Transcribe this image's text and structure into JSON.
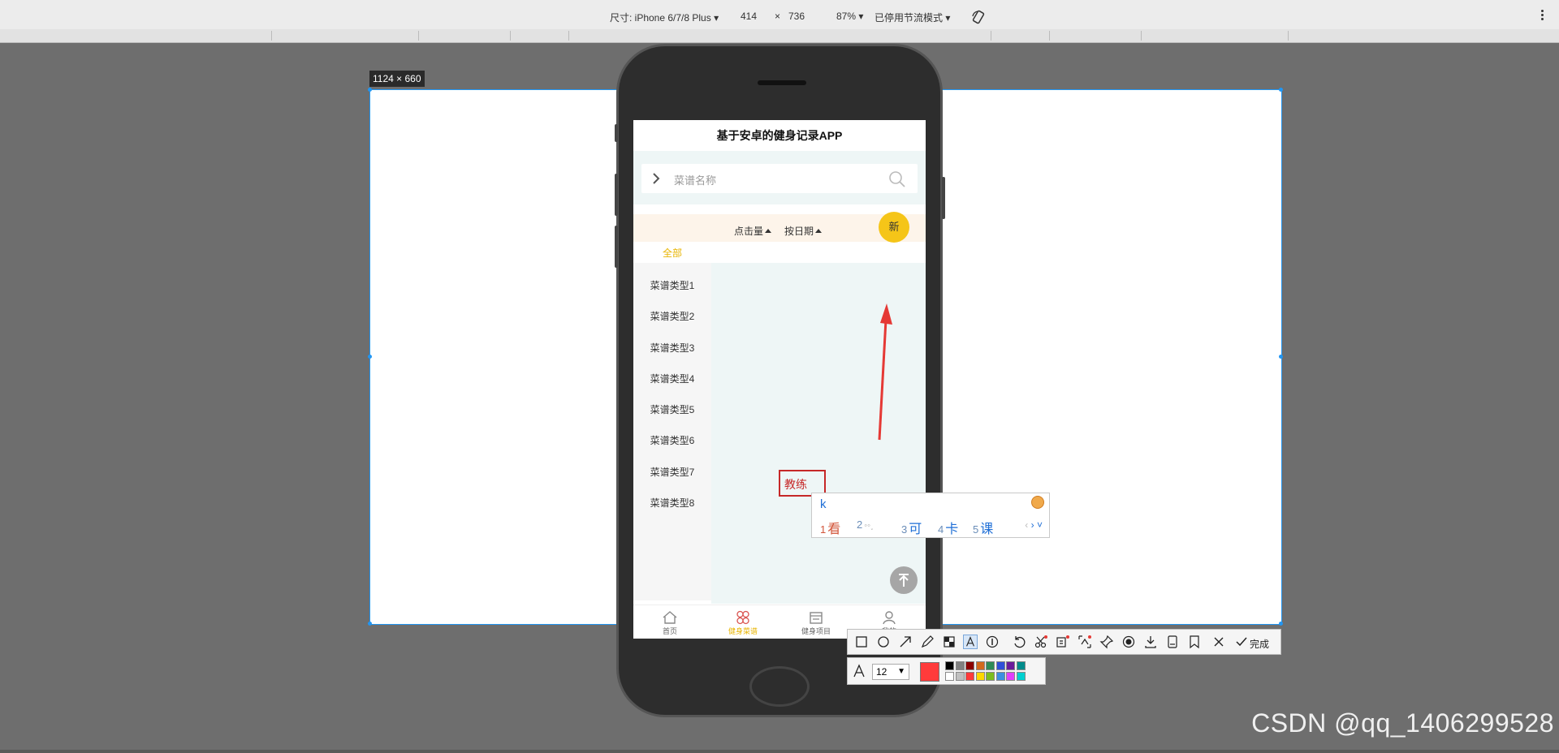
{
  "devtools": {
    "device_label": "尺寸: iPhone 6/7/8 Plus",
    "width": "414",
    "times": "×",
    "height": "736",
    "zoom": "87%",
    "throttle": "已停用节流模式"
  },
  "selection": {
    "dimensions": "1124 × 660"
  },
  "app": {
    "title": "基于安卓的健身记录APP",
    "search_placeholder": "菜谱名称",
    "sort_clicks": "点击量",
    "sort_date": "按日期",
    "new_button": "新",
    "categories": [
      "全部",
      "菜谱类型1",
      "菜谱类型2",
      "菜谱类型3",
      "菜谱类型4",
      "菜谱类型5",
      "菜谱类型6",
      "菜谱类型7",
      "菜谱类型8"
    ],
    "tabs": [
      "首页",
      "健身菜谱",
      "健身项目",
      "我的"
    ]
  },
  "annotation": {
    "text": "教练"
  },
  "ime": {
    "input": "k",
    "candidates": [
      {
        "num": "1",
        "text": "看"
      },
      {
        "num": "2",
        "text": ""
      },
      {
        "num": "3",
        "text": "可"
      },
      {
        "num": "4",
        "text": "卡"
      },
      {
        "num": "5",
        "text": "课"
      }
    ]
  },
  "snip_toolbar": {
    "tools": [
      "rectangle-tool",
      "ellipse-tool",
      "arrow-tool",
      "pen-tool",
      "mosaic-tool",
      "text-tool",
      "number-tool",
      "undo-tool",
      "cut-tool",
      "ocr-tool",
      "translate-tool",
      "pin-tool",
      "record-tool",
      "save-tool",
      "long-screenshot-tool",
      "bookmark-tool",
      "close-tool"
    ],
    "done_label": "完成",
    "font_size": "12",
    "current_color": "#ff3b3b",
    "palette": [
      "#000000",
      "#808080",
      "#8b0000",
      "#d2691e",
      "#2e8b57",
      "#2f4fd8",
      "#6a1b9a",
      "#008b8b",
      "#ffffff",
      "#c0c0c0",
      "#ff3b3b",
      "#ffd700",
      "#7cbd1e",
      "#3d8fe0",
      "#e040fb",
      "#00d0d0"
    ]
  },
  "watermark": "CSDN @qq_1406299528"
}
